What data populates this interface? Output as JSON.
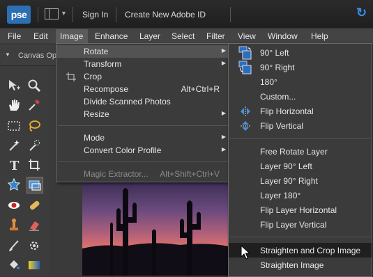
{
  "app": {
    "logo_text": "pse",
    "accent": "#3a8ee6"
  },
  "topbar": {
    "sign_in": "Sign In",
    "create_id": "Create New Adobe ID"
  },
  "menubar": [
    "File",
    "Edit",
    "Image",
    "Enhance",
    "Layer",
    "Select",
    "Filter",
    "View",
    "Window",
    "Help"
  ],
  "options_bar": {
    "label": "Canvas Op"
  },
  "image_menu": [
    {
      "label": "Rotate",
      "shortcut": "",
      "submenu": true,
      "highlighted": true
    },
    {
      "label": "Transform",
      "shortcut": "",
      "submenu": true
    },
    {
      "label": "Crop",
      "shortcut": "",
      "icon": "crop-icon"
    },
    {
      "label": "Recompose",
      "shortcut": "Alt+Ctrl+R"
    },
    {
      "label": "Divide Scanned Photos",
      "shortcut": ""
    },
    {
      "label": "Resize",
      "shortcut": "",
      "submenu": true
    },
    {
      "label": "Mode",
      "shortcut": "",
      "submenu": true
    },
    {
      "label": "Convert Color Profile",
      "shortcut": "",
      "submenu": true
    },
    {
      "label": "Magic Extractor...",
      "shortcut": "Alt+Shift+Ctrl+V",
      "disabled": true
    }
  ],
  "rotate_menu": [
    {
      "label": "90° Left",
      "icon": "rotate-left-icon"
    },
    {
      "label": "90° Right",
      "icon": "rotate-right-icon"
    },
    {
      "label": "180°"
    },
    {
      "label": "Custom..."
    },
    {
      "label": "Flip Horizontal",
      "icon": "flip-horizontal-icon"
    },
    {
      "label": "Flip Vertical",
      "icon": "flip-vertical-icon"
    },
    {
      "label": "Free Rotate Layer"
    },
    {
      "label": "Layer 90° Left"
    },
    {
      "label": "Layer 90° Right"
    },
    {
      "label": "Layer 180°"
    },
    {
      "label": "Flip Layer Horizontal"
    },
    {
      "label": "Flip Layer Vertical"
    },
    {
      "label": "Straighten and Crop Image",
      "highlighted": true
    },
    {
      "label": "Straighten Image"
    }
  ]
}
